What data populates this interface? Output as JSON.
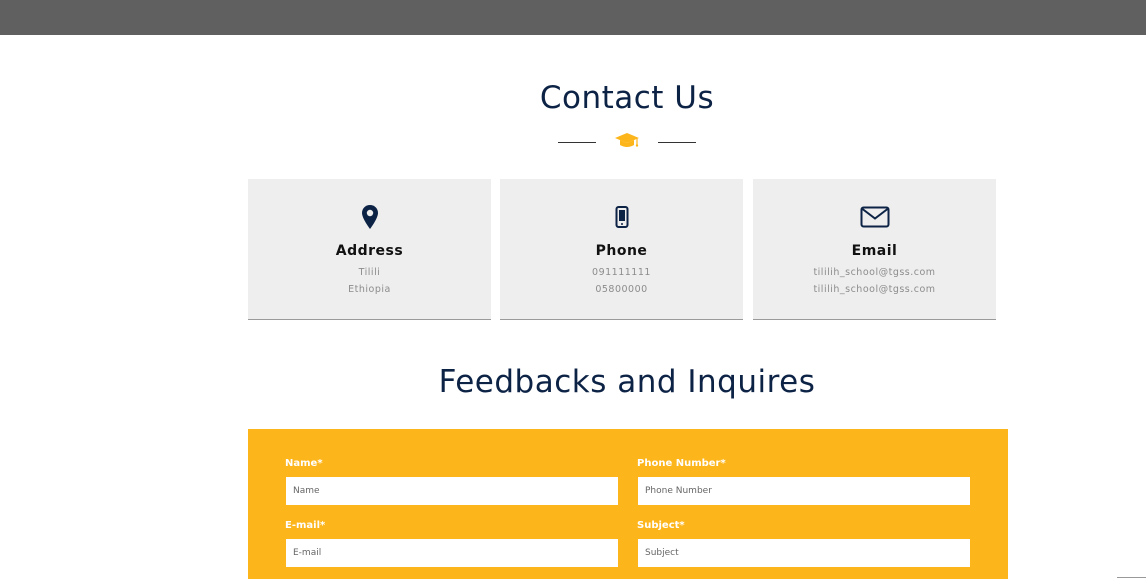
{
  "contact": {
    "title": "Contact Us",
    "cards": [
      {
        "icon": "map-pin-icon",
        "title": "Address",
        "line1": "Tilili",
        "line2": "Ethiopia"
      },
      {
        "icon": "mobile-phone-icon",
        "title": "Phone",
        "line1": "091111111",
        "line2": "05800000"
      },
      {
        "icon": "envelope-icon",
        "title": "Email",
        "line1": "tililih_school@tgss.com",
        "line2": "tililih_school@tgss.com"
      }
    ]
  },
  "feedback": {
    "title": "Feedbacks and Inquires",
    "fields": {
      "name": {
        "label": "Name*",
        "placeholder": "Name",
        "value": ""
      },
      "phone": {
        "label": "Phone Number*",
        "placeholder": "Phone Number",
        "value": ""
      },
      "email": {
        "label": "E-mail*",
        "placeholder": "E-mail",
        "value": ""
      },
      "subject": {
        "label": "Subject*",
        "placeholder": "Subject",
        "value": ""
      }
    }
  },
  "colors": {
    "heading": "#0d2346",
    "accent": "#fdb51c",
    "topbar": "#5f605f",
    "card": "#eeeeee"
  },
  "icons": {
    "divider": "graduation-cap-icon"
  }
}
